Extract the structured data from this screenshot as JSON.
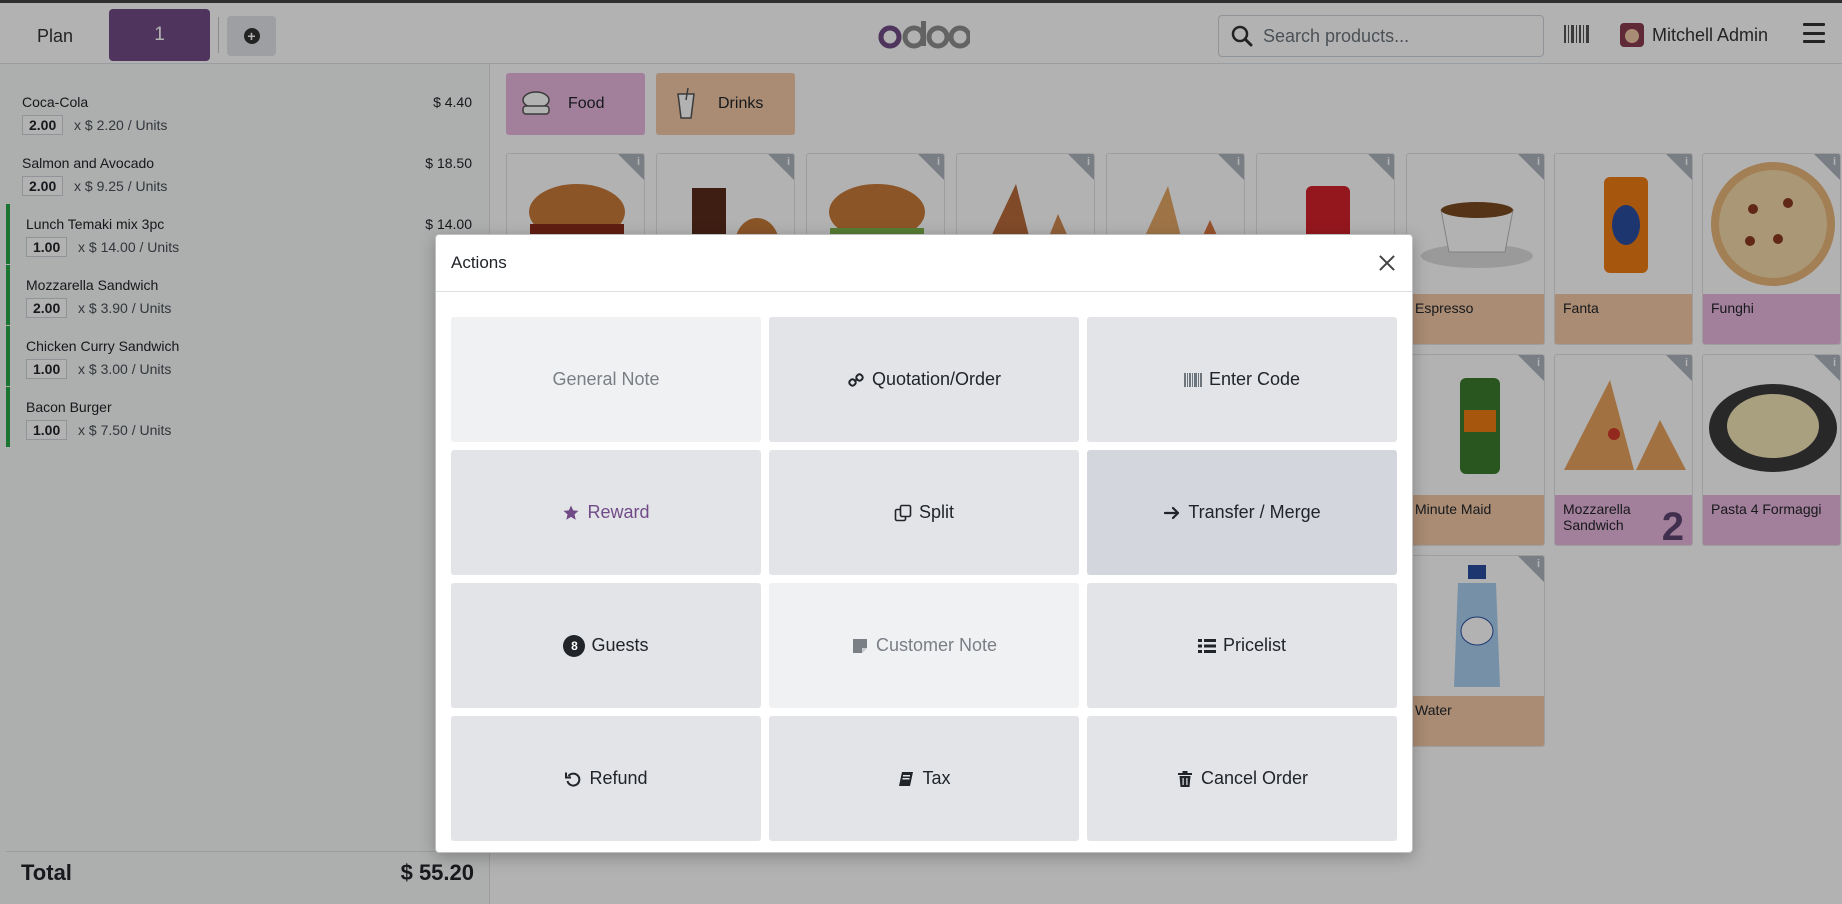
{
  "header": {
    "plan_label": "Plan",
    "order_tab": "1",
    "logo_text": "odoo",
    "search_placeholder": "Search products...",
    "user_name": "Mitchell Admin"
  },
  "orderlines": [
    {
      "name": "Coca-Cola",
      "qty": "2.00",
      "unit": "x $ 2.20 / Units",
      "price": "$ 4.40",
      "sent": false
    },
    {
      "name": "Salmon and Avocado",
      "qty": "2.00",
      "unit": "x $ 9.25 / Units",
      "price": "$ 18.50",
      "sent": false
    },
    {
      "name": "Lunch Temaki mix 3pc",
      "qty": "1.00",
      "unit": "x $ 14.00 / Units",
      "price": "$ 14.00",
      "sent": true
    },
    {
      "name": "Mozzarella Sandwich",
      "qty": "2.00",
      "unit": "x $ 3.90 / Units",
      "price": "",
      "sent": true
    },
    {
      "name": "Chicken Curry Sandwich",
      "qty": "1.00",
      "unit": "x $ 3.00 / Units",
      "price": "",
      "sent": true
    },
    {
      "name": "Bacon Burger",
      "qty": "1.00",
      "unit": "x $ 7.50 / Units",
      "price": "",
      "sent": true
    }
  ],
  "total": {
    "label": "Total",
    "value": "$ 55.20"
  },
  "categories": [
    {
      "label": "Food",
      "color": "#e9b6de"
    },
    {
      "label": "Drinks",
      "color": "#f4c9a6"
    }
  ],
  "products": {
    "espresso": "Espresso",
    "fanta": "Fanta",
    "funghi": "Funghi",
    "minute_maid": "Minute Maid",
    "mozzarella_sandwich": "Mozzarella Sandwich",
    "mozzarella_count": "2",
    "pasta": "Pasta 4 Formaggi",
    "water": "Water"
  },
  "modal": {
    "title": "Actions",
    "actions": {
      "general_note": "General Note",
      "quotation_order": "Quotation/Order",
      "enter_code": "Enter Code",
      "reward": "Reward",
      "split": "Split",
      "transfer_merge": "Transfer / Merge",
      "guests": "Guests",
      "guests_count": "8",
      "customer_note": "Customer Note",
      "pricelist": "Pricelist",
      "refund": "Refund",
      "tax": "Tax",
      "cancel_order": "Cancel Order"
    }
  },
  "colors": {
    "brand": "#714b87",
    "food_category": "#e9b6de",
    "drink_category": "#f4c9a6",
    "sent_line": "#28a745"
  },
  "icons": [
    "plus-circle-icon",
    "search-icon",
    "barcode-icon",
    "hamburger-menu-icon",
    "close-icon",
    "link-icon",
    "barcode-icon",
    "star-icon",
    "copy-icon",
    "arrow-right-icon",
    "sticky-note-icon",
    "list-icon",
    "undo-icon",
    "book-icon",
    "trash-icon"
  ]
}
